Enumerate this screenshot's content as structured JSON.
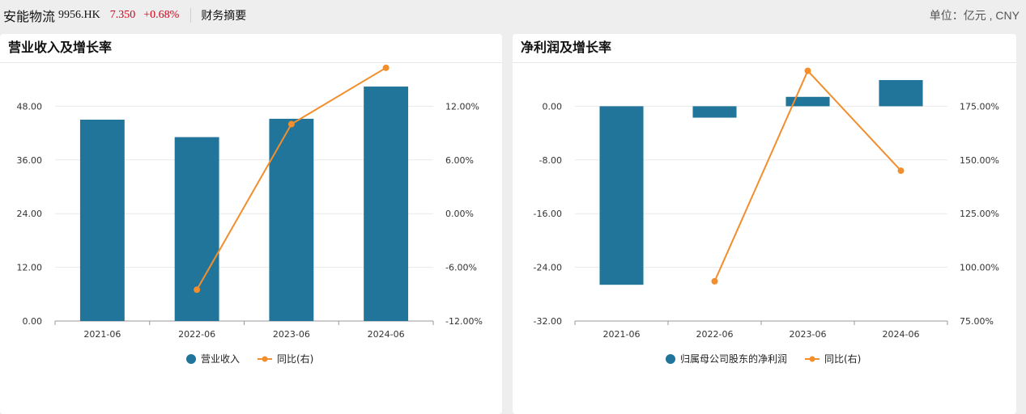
{
  "header": {
    "stock_name": "安能物流",
    "stock_code": "9956.HK",
    "price": "7.350",
    "change": "+0.68%",
    "tab_label": "财务摘要",
    "unit_label": "单位：亿元 , CNY",
    "price_color": "#d0021b"
  },
  "chart_data": [
    {
      "type": "bar",
      "title": "营业收入及增长率",
      "categories": [
        "2021-06",
        "2022-06",
        "2023-06",
        "2024-06"
      ],
      "series": [
        {
          "name": "营业收入",
          "type": "bar",
          "axis": "left",
          "color": "#21759b",
          "values": [
            45.0,
            41.1,
            45.2,
            52.4
          ]
        },
        {
          "name": "同比(右)",
          "type": "line",
          "axis": "right",
          "color": "#f28e2b",
          "values": [
            null,
            -8.5,
            10.0,
            16.3
          ]
        }
      ],
      "y_left": {
        "min": 0,
        "max": 60,
        "ticks": [
          "0.00",
          "12.00",
          "24.00",
          "36.00",
          "48.00",
          "60.00"
        ]
      },
      "y_right": {
        "min": -12,
        "max": 18,
        "ticks": [
          "-12.00%",
          "-6.00%",
          "0.00%",
          "6.00%",
          "12.00%",
          "18.00%"
        ]
      },
      "grid": true,
      "legend_position": "bottom"
    },
    {
      "type": "bar",
      "title": "净利润及增长率",
      "categories": [
        "2021-06",
        "2022-06",
        "2023-06",
        "2024-06"
      ],
      "series": [
        {
          "name": "归属母公司股东的净利润",
          "type": "bar",
          "axis": "left",
          "color": "#21759b",
          "values": [
            -26.6,
            -1.7,
            1.4,
            3.9
          ]
        },
        {
          "name": "同比(右)",
          "type": "line",
          "axis": "right",
          "color": "#f28e2b",
          "values": [
            null,
            93.5,
            191.5,
            145.0
          ]
        }
      ],
      "y_left": {
        "min": -32,
        "max": 8,
        "ticks": [
          "-32.00",
          "-24.00",
          "-16.00",
          "-8.00",
          "0.00",
          "8.00"
        ]
      },
      "y_right": {
        "min": 75,
        "max": 200,
        "ticks": [
          "75.00%",
          "100.00%",
          "125.00%",
          "150.00%",
          "175.00%",
          "200.00%"
        ]
      },
      "grid": true,
      "legend_position": "bottom"
    }
  ]
}
